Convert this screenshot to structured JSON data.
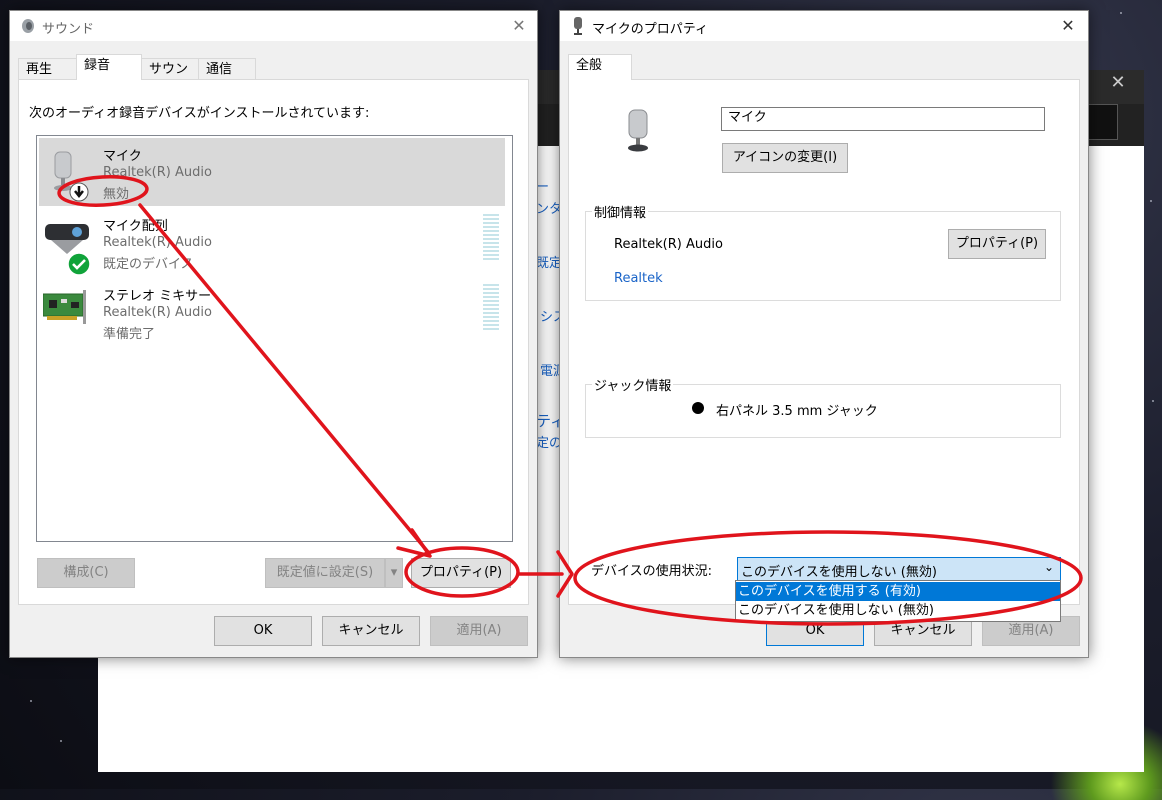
{
  "sound_dialog": {
    "title": "サウンド",
    "close": "✕",
    "tabs": [
      "再生",
      "録音",
      "サウンド",
      "通信"
    ],
    "active_tab": "録音",
    "instruction": "次のオーディオ録音デバイスがインストールされています:",
    "devices": [
      {
        "name": "マイク",
        "driver": "Realtek(R) Audio",
        "status": "無効"
      },
      {
        "name": "マイク配列",
        "driver": "Realtek(R) Audio",
        "status": "既定のデバイス"
      },
      {
        "name": "ステレオ ミキサー",
        "driver": "Realtek(R) Audio",
        "status": "準備完了"
      }
    ],
    "configure_button": "構成(C)",
    "set_default_button": "既定値に設定(S)",
    "properties_button": "プロパティ(P)",
    "ok_button": "OK",
    "cancel_button": "キャンセル",
    "apply_button": "適用(A)"
  },
  "mic_props_dialog": {
    "title": "マイクのプロパティ",
    "close": "✕",
    "tab": "全般",
    "name_value": "マイク",
    "change_icon_button": "アイコンの変更(I)",
    "controller_group": "制御情報",
    "controller_name": "Realtek(R) Audio",
    "controller_properties_button": "プロパティ(P)",
    "vendor_link": "Realtek",
    "jack_group": "ジャック情報",
    "jack_text": "右パネル 3.5 mm ジャック",
    "usage_label": "デバイスの使用状況:",
    "usage_selected": "このデバイスを使用しない (無効)",
    "usage_options": [
      "このデバイスを使用する (有効)",
      "このデバイスを使用しない (無効)"
    ],
    "ok_button": "OK",
    "cancel_button": "キャンセル",
    "apply_button": "適用(A)"
  },
  "background_window": {
    "close": "✕",
    "links": [
      "ー",
      "ンター",
      "既定",
      "シス",
      "電源",
      "ティ",
      "定の設"
    ]
  },
  "colors": {
    "annotation_red": "#e0141c",
    "accent_blue": "#0078d7",
    "link_blue": "#1a64c8"
  }
}
